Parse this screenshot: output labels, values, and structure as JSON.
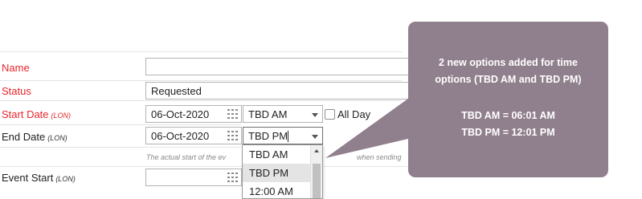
{
  "form": {
    "name": {
      "label": "Name",
      "value": ""
    },
    "status": {
      "label": "Status",
      "value": "Requested"
    },
    "start_date": {
      "label": "Start Date",
      "tz": "(LON)",
      "date": "06-Oct-2020",
      "time": "TBD AM",
      "all_day_label": "All Day"
    },
    "end_date": {
      "label": "End Date",
      "tz": "(LON)",
      "date": "06-Oct-2020",
      "time": "TBD PM"
    },
    "help_left": "The actual start of the ev",
    "help_right": "when sending",
    "event_start": {
      "label": "Event Start",
      "tz": "(LON)",
      "date": ""
    }
  },
  "time_dropdown": {
    "options": [
      "TBD AM",
      "TBD PM",
      "12:00 AM"
    ],
    "selected": "TBD PM"
  },
  "callout": {
    "line1": "2 new options added for time",
    "line2": "options (TBD AM and TBD PM)",
    "line3": "TBD AM = 06:01 AM",
    "line4": "TBD PM = 12:01 PM"
  },
  "colors": {
    "required_label": "#e8252b",
    "callout_bg": "#907f8c",
    "selected_option": "#e4e4e4"
  },
  "icons": [
    "calendar-icon",
    "dropdown-arrow-icon",
    "scroll-up-icon"
  ]
}
